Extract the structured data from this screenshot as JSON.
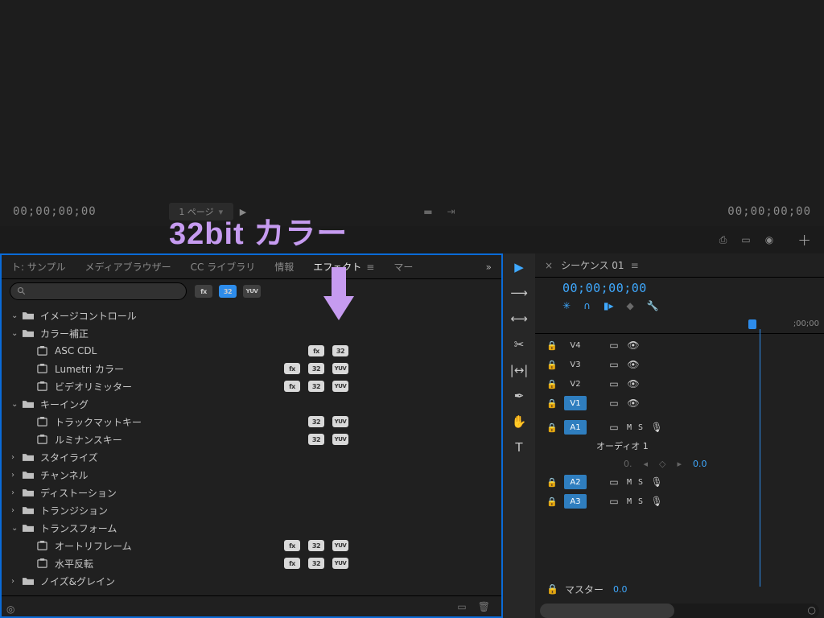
{
  "viewer": {
    "timecode_left": "00;00;00;00",
    "timecode_right": "00;00;00;00",
    "page_pill": "1 ページ"
  },
  "annotation": {
    "text": "32bit カラー"
  },
  "effects_panel": {
    "tabs": [
      "ト: サンプル",
      "メディアブラウザー",
      "CC ライブラリ",
      "情報",
      "エフェクト",
      "マー"
    ],
    "active_tab_index": 4,
    "search_placeholder": "",
    "filter_badges": [
      "fx",
      "32",
      "YUV"
    ],
    "filter_badge_selected": 1,
    "tree": [
      {
        "type": "folder",
        "open": true,
        "label": "イメージコントロール",
        "children": []
      },
      {
        "type": "folder",
        "open": true,
        "label": "カラー補正",
        "children": [
          {
            "type": "preset",
            "label": "ASC CDL",
            "badges": [
              "fx",
              "32"
            ]
          },
          {
            "type": "preset",
            "label": "Lumetri カラー",
            "badges": [
              "fx",
              "32",
              "YUV"
            ]
          },
          {
            "type": "preset",
            "label": "ビデオリミッター",
            "badges": [
              "fx",
              "32",
              "YUV"
            ]
          }
        ]
      },
      {
        "type": "folder",
        "open": true,
        "label": "キーイング",
        "children": [
          {
            "type": "preset",
            "label": "トラックマットキー",
            "badges": [
              "32",
              "YUV"
            ]
          },
          {
            "type": "preset",
            "label": "ルミナンスキー",
            "badges": [
              "32",
              "YUV"
            ]
          }
        ]
      },
      {
        "type": "folder",
        "open": false,
        "label": "スタイライズ",
        "children": []
      },
      {
        "type": "folder",
        "open": false,
        "label": "チャンネル",
        "children": []
      },
      {
        "type": "folder",
        "open": false,
        "label": "ディストーション",
        "children": []
      },
      {
        "type": "folder",
        "open": false,
        "label": "トランジション",
        "children": []
      },
      {
        "type": "folder",
        "open": true,
        "label": "トランスフォーム",
        "children": [
          {
            "type": "preset",
            "label": "オートリフレーム",
            "badges": [
              "fx",
              "32",
              "YUV"
            ]
          },
          {
            "type": "preset",
            "label": "水平反転",
            "badges": [
              "fx",
              "32",
              "YUV"
            ]
          }
        ]
      },
      {
        "type": "folder",
        "open": false,
        "label": "ノイズ&グレイン",
        "children": []
      }
    ]
  },
  "tool_strip": {
    "tools": [
      "selection",
      "ripple",
      "rolling",
      "razor",
      "slip",
      "pen",
      "hand",
      "type"
    ],
    "selected": 0
  },
  "timeline": {
    "sequence_name": "シーケンス 01",
    "timecode": "00;00;00;00",
    "ruler_label": ";00;00",
    "video_tracks": [
      "V4",
      "V3",
      "V2",
      "V1"
    ],
    "video_selected_index": 3,
    "audio_tracks": [
      "A1",
      "A2",
      "A3"
    ],
    "audio_label": "オーディオ 1",
    "audio_sub_value": "0.",
    "audio_sub_right": "0.0",
    "master_label": "マスター",
    "master_value": "0.0",
    "ms_label": "M   S"
  }
}
